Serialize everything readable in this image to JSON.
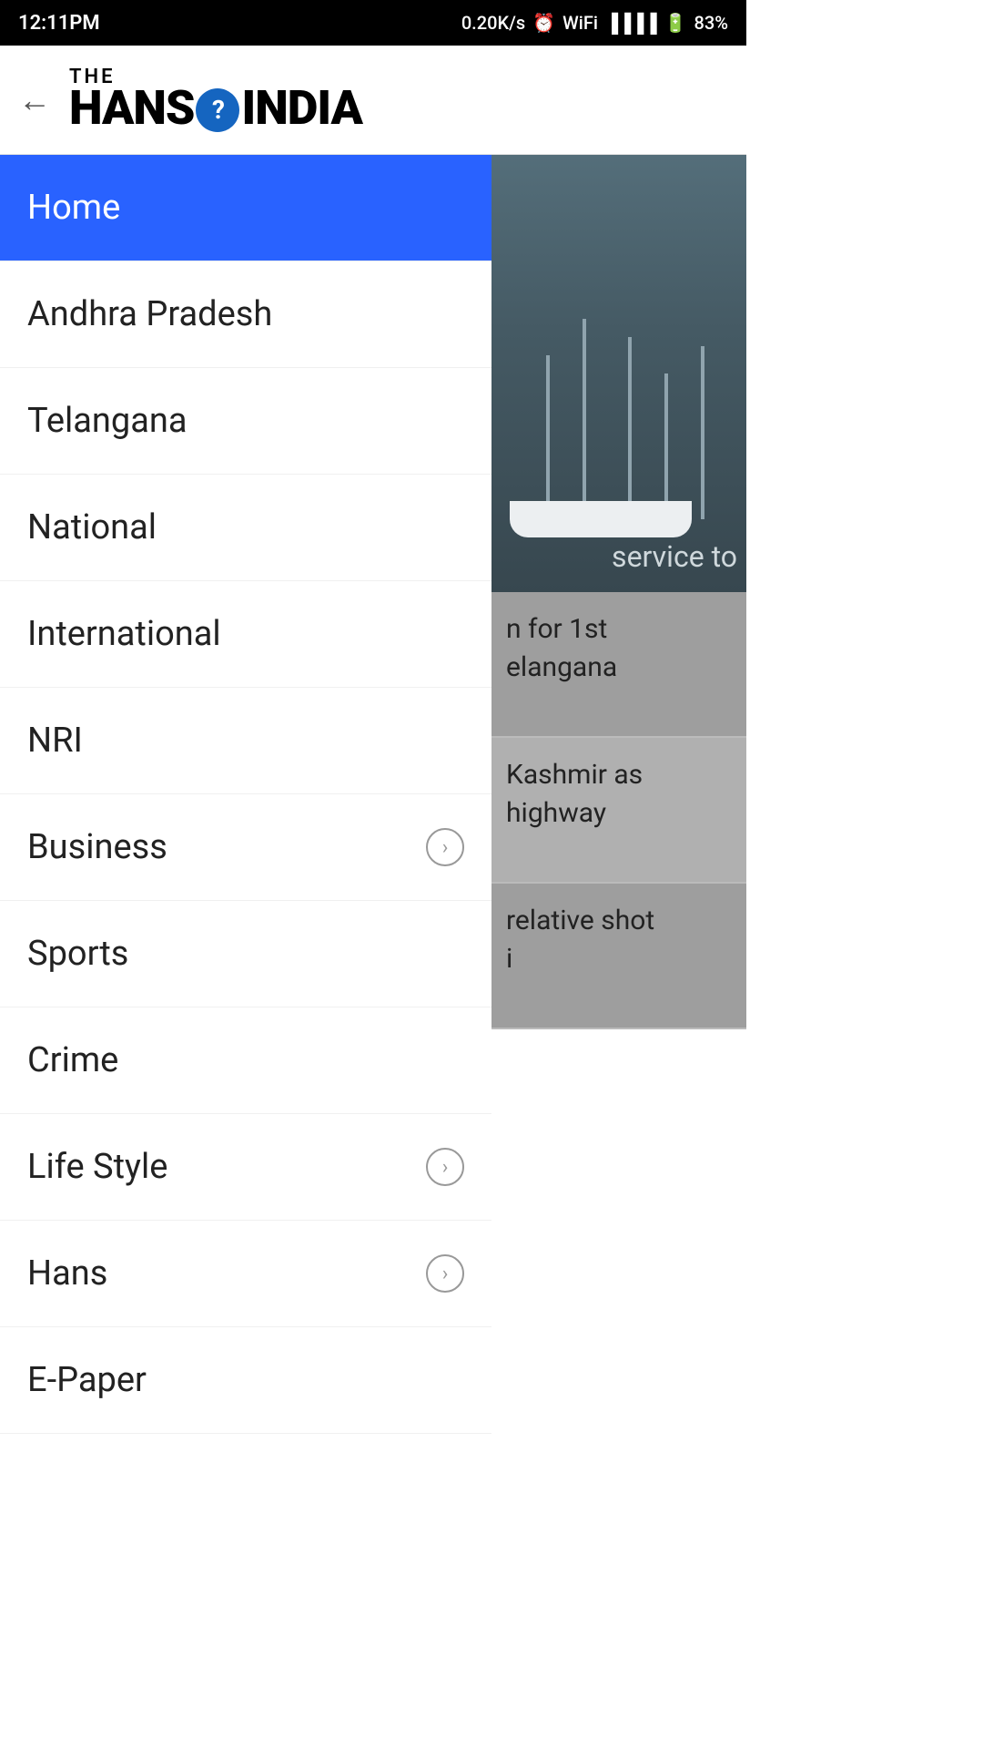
{
  "statusBar": {
    "time": "12:11PM",
    "speed": "0.20K/s",
    "battery": "83%"
  },
  "header": {
    "logoThe": "THE",
    "logoMain1": "HANS",
    "logoMain2": "INDIA",
    "backLabel": "←"
  },
  "menu": {
    "items": [
      {
        "id": "home",
        "label": "Home",
        "active": true,
        "hasChevron": false
      },
      {
        "id": "andhra-pradesh",
        "label": "Andhra Pradesh",
        "active": false,
        "hasChevron": false
      },
      {
        "id": "telangana",
        "label": "Telangana",
        "active": false,
        "hasChevron": false
      },
      {
        "id": "national",
        "label": "National",
        "active": false,
        "hasChevron": false
      },
      {
        "id": "international",
        "label": "International",
        "active": false,
        "hasChevron": false
      },
      {
        "id": "nri",
        "label": "NRI",
        "active": false,
        "hasChevron": false
      },
      {
        "id": "business",
        "label": "Business",
        "active": false,
        "hasChevron": true
      },
      {
        "id": "sports",
        "label": "Sports",
        "active": false,
        "hasChevron": false
      },
      {
        "id": "crime",
        "label": "Crime",
        "active": false,
        "hasChevron": false
      },
      {
        "id": "life-style",
        "label": "Life Style",
        "active": false,
        "hasChevron": true
      },
      {
        "id": "hans",
        "label": "Hans",
        "active": false,
        "hasChevron": true
      },
      {
        "id": "e-paper",
        "label": "E-Paper",
        "active": false,
        "hasChevron": false
      }
    ]
  },
  "rightContent": {
    "imageOverlayText": "service to",
    "newsItem1Line1": "n for 1st",
    "newsItem1Line2": "elangana",
    "newsItem2Line1": "Kashmir as",
    "newsItem2Line2": "highway",
    "newsItem3Line1": "relative shot",
    "newsItem3Line2": "i"
  }
}
